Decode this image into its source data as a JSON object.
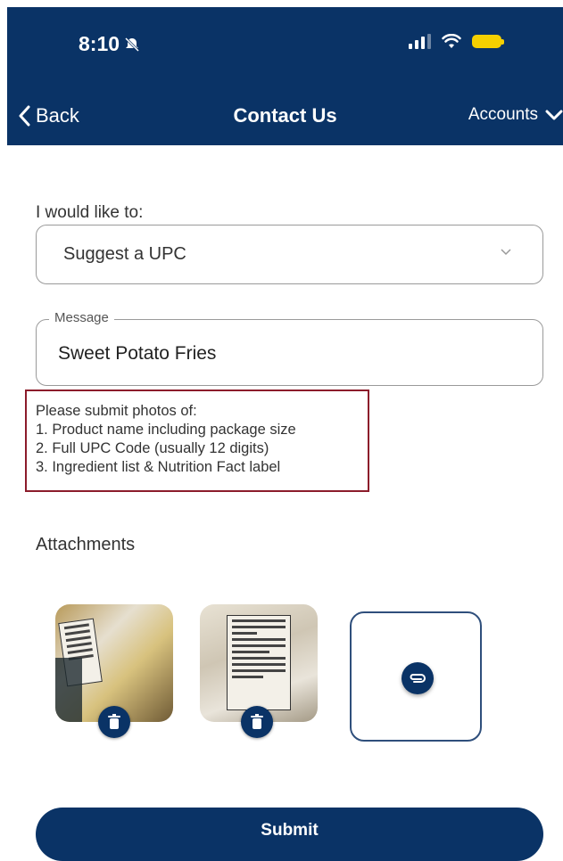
{
  "status_bar": {
    "time": "8:10"
  },
  "nav": {
    "back_label": "Back",
    "title": "Contact Us",
    "accounts_label": "Accounts"
  },
  "form": {
    "intent_label": "I would like to:",
    "intent_selected": "Suggest a UPC",
    "message_label": "Message",
    "message_value": "Sweet Potato Fries"
  },
  "notice": {
    "lines": [
      "Please submit photos of:",
      "1. Product name including package size",
      "2. Full UPC Code (usually 12 digits)",
      "3. Ingredient list & Nutrition Fact label"
    ]
  },
  "attachments": {
    "label": "Attachments",
    "count": 2
  },
  "submit_label": "Submit",
  "colors": {
    "primary": "#0a3366",
    "notice_border": "#8c1c2b",
    "battery": "#f5d000"
  }
}
